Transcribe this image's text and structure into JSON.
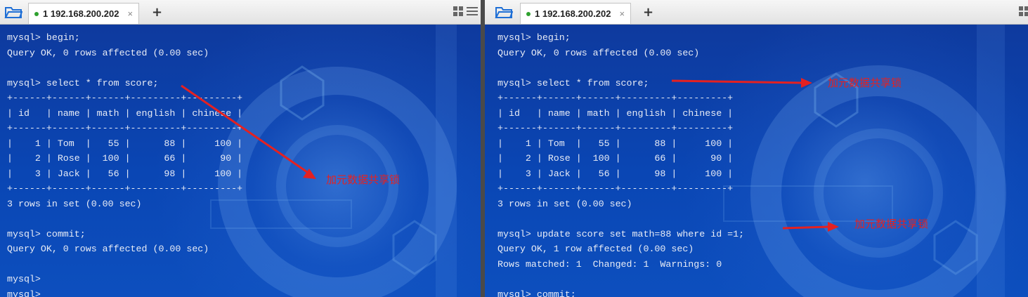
{
  "panes": [
    {
      "tab_label": "1 192.168.200.202",
      "close_glyph": "×",
      "new_tab_glyph": "+",
      "icons": [
        "folder-icon",
        "tile-icon",
        "menu-icon"
      ],
      "lines": [
        "mysql> begin;",
        "Query OK, 0 rows affected (0.00 sec)",
        "",
        "mysql> select * from score;",
        "+------+------+------+---------+---------+",
        "| id   | name | math | english | chinese |",
        "+------+------+------+---------+---------+",
        "|    1 | Tom  |   55 |      88 |     100 |",
        "|    2 | Rose |  100 |      66 |      90 |",
        "|    3 | Jack |   56 |      98 |     100 |",
        "+------+------+------+---------+---------+",
        "3 rows in set (0.00 sec)",
        "",
        "mysql> commit;",
        "Query OK, 0 rows affected (0.00 sec)",
        "",
        "mysql>",
        "mysql>"
      ],
      "annotations": [
        "加元数据共享锁"
      ]
    },
    {
      "tab_label": "1 192.168.200.202",
      "close_glyph": "×",
      "new_tab_glyph": "+",
      "icons": [
        "folder-icon",
        "tile-icon"
      ],
      "lines": [
        "mysql> begin;",
        "Query OK, 0 rows affected (0.00 sec)",
        "",
        "mysql> select * from score;",
        "+------+------+------+---------+---------+",
        "| id   | name | math | english | chinese |",
        "+------+------+------+---------+---------+",
        "|    1 | Tom  |   55 |      88 |     100 |",
        "|    2 | Rose |  100 |      66 |      90 |",
        "|    3 | Jack |   56 |      98 |     100 |",
        "+------+------+------+---------+---------+",
        "3 rows in set (0.00 sec)",
        "",
        "mysql> update score set math=88 where id =1;",
        "Query OK, 1 row affected (0.00 sec)",
        "Rows matched: 1  Changed: 1  Warnings: 0",
        "",
        "mysql> commit;"
      ],
      "annotations": [
        "加元数据共享锁",
        "加元数据共享锁"
      ]
    }
  ],
  "colors": {
    "terminal_bg": "#0b3fa8",
    "terminal_text": "#e8ecf6",
    "annotation": "#e42121",
    "tab_dot": "#2fa12f"
  }
}
